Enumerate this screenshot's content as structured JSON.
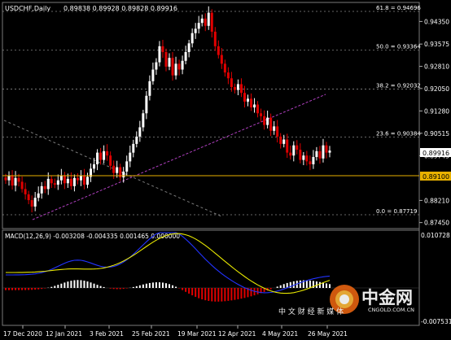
{
  "header": {
    "symbol_label": "USDCHF,Daily",
    "ohlc": "0.89838 0.89928 0.89828 0.89916"
  },
  "fib_levels": [
    {
      "label": "61.8 = 0.94696",
      "value": 0.94696
    },
    {
      "label": "50.0 = 0.93364",
      "value": 0.93364
    },
    {
      "label": "38.2 = 0.92032",
      "value": 0.92032
    },
    {
      "label": "23.6 = 0.90384",
      "value": 0.90384
    },
    {
      "label": "0.0 = 0.87719",
      "value": 0.87719
    }
  ],
  "price_axis": {
    "ticks": [
      "0.94350",
      "0.93575",
      "0.92810",
      "0.92050",
      "0.91280",
      "0.90515",
      "0.89745",
      "0.88210",
      "0.87450"
    ],
    "current_price": "0.89916",
    "horizontal_line_price": "0.89100"
  },
  "time_axis": [
    "17 Dec 2020",
    "12 Jan 2021",
    "3 Feb 2021",
    "25 Feb 2021",
    "19 Mar 2021",
    "12 Apr 2021",
    "4 May 2021",
    "26 May 2021"
  ],
  "macd": {
    "label": "MACD(12,26,9) -0.003208 -0.004335 0.001465 0.000000",
    "axis_top": "0.010728",
    "axis_bottom": "-0.007531"
  },
  "watermark": {
    "brand": "中金网",
    "domain": "CNGOLD.COM.CN",
    "tagline": "中 文 财 经 新 媒 体"
  },
  "colors": {
    "background": "#000000",
    "bull": "#ffffff",
    "bear": "#e00000",
    "grid": "#5a5a5a",
    "fib": "#888888",
    "trendline": "#b040c0",
    "support_line": "#e8b100",
    "macd_line": "#2233ff",
    "signal_line": "#e8e800",
    "label_bg": "#ffffff"
  }
}
